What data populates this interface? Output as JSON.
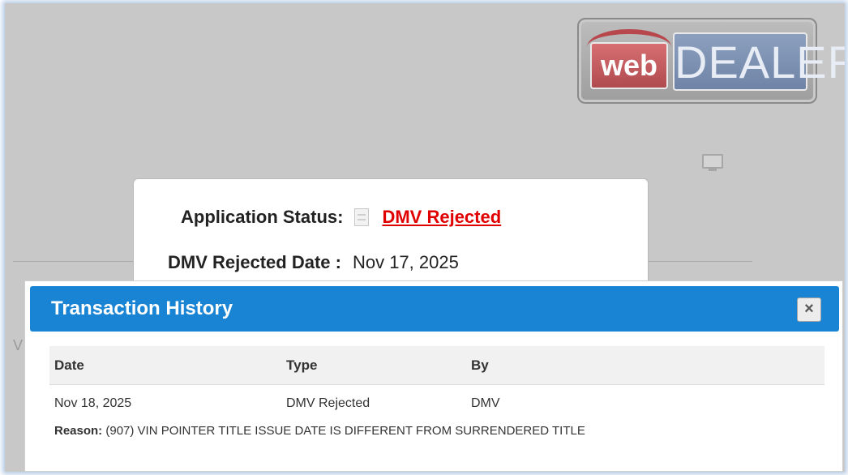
{
  "logo": {
    "part1": "web",
    "part2": "DEALER"
  },
  "status": {
    "application_status_label": "Application Status:",
    "application_status_value": "DMV Rejected",
    "rejected_date_label": "DMV Rejected Date :",
    "rejected_date_value": "Nov 17, 2025"
  },
  "background": {
    "partial_letter": "V"
  },
  "modal": {
    "title": "Transaction History",
    "close_label": "×",
    "headers": {
      "date": "Date",
      "type": "Type",
      "by": "By"
    },
    "row": {
      "date": "Nov 18, 2025",
      "type": "DMV Rejected",
      "by": "DMV"
    },
    "reason_label": "Reason:",
    "reason_text": " (907) VIN POINTER TITLE ISSUE DATE IS DIFFERENT FROM SURRENDERED TITLE"
  },
  "colors": {
    "header_blue": "#1a84d4",
    "rejected_red": "#e00000"
  }
}
